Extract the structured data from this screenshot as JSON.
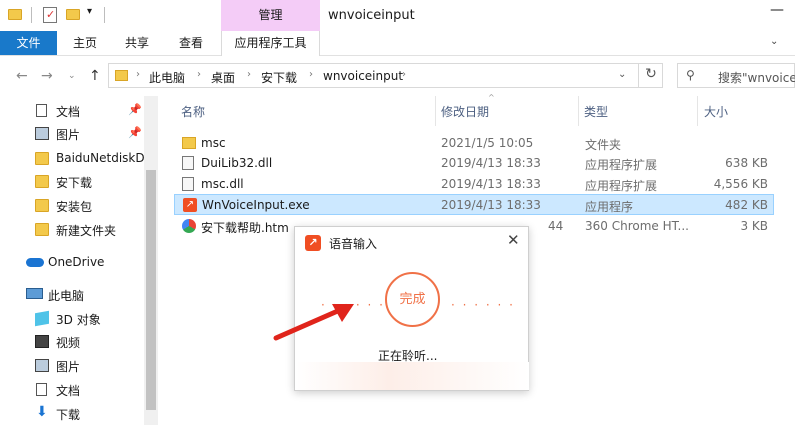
{
  "titlebar": {
    "context_tab": "管理",
    "window_title": "wnvoiceinput",
    "minimize_icon": "—"
  },
  "ribbon": {
    "tabs": [
      "文件",
      "主页",
      "共享",
      "查看",
      "应用程序工具"
    ]
  },
  "address": {
    "crumbs": [
      "此电脑",
      "桌面",
      "安下载",
      "wnvoiceinput"
    ],
    "search_placeholder": "搜索\"wnvoiceinput\""
  },
  "sidebar": {
    "items": [
      {
        "label": "文档",
        "icon": "document-icon",
        "pinned": true
      },
      {
        "label": "图片",
        "icon": "picture-icon",
        "pinned": true
      },
      {
        "label": "BaiduNetdiskD",
        "icon": "folder-icon",
        "pinned": false
      },
      {
        "label": "安下载",
        "icon": "folder-icon",
        "pinned": false
      },
      {
        "label": "安装包",
        "icon": "folder-icon",
        "pinned": false
      },
      {
        "label": "新建文件夹",
        "icon": "folder-icon",
        "pinned": false
      },
      {
        "label": "OneDrive",
        "icon": "onedrive-icon",
        "pinned": false
      },
      {
        "label": "此电脑",
        "icon": "computer-icon",
        "pinned": false
      },
      {
        "label": "3D 对象",
        "icon": "3d-objects-icon",
        "pinned": false
      },
      {
        "label": "视频",
        "icon": "video-icon",
        "pinned": false
      },
      {
        "label": "图片",
        "icon": "picture-icon",
        "pinned": false
      },
      {
        "label": "文档",
        "icon": "document-icon",
        "pinned": false
      },
      {
        "label": "下载",
        "icon": "download-icon",
        "pinned": false
      }
    ]
  },
  "filelist": {
    "columns": [
      "名称",
      "修改日期",
      "类型",
      "大小"
    ],
    "rows": [
      {
        "name": "msc",
        "date": "2021/1/5 10:05",
        "type": "文件夹",
        "size": "",
        "icon": "folder-icon"
      },
      {
        "name": "DuiLib32.dll",
        "date": "2019/4/13 18:33",
        "type": "应用程序扩展",
        "size": "638 KB",
        "icon": "dll-icon"
      },
      {
        "name": "msc.dll",
        "date": "2019/4/13 18:33",
        "type": "应用程序扩展",
        "size": "4,556 KB",
        "icon": "dll-icon"
      },
      {
        "name": "WnVoiceInput.exe",
        "date": "2019/4/13 18:33",
        "type": "应用程序",
        "size": "482 KB",
        "icon": "exe-icon"
      },
      {
        "name": "安下载帮助.htm",
        "date": "44",
        "type": "360 Chrome HT...",
        "size": "3 KB",
        "icon": "htm-icon"
      }
    ]
  },
  "dialog": {
    "title": "语音输入",
    "button": "完成",
    "status": "正在聆听...",
    "accent": "#f07147"
  },
  "colors": {
    "file_tab": "#1979ca",
    "context_tab": "#f4ccf7",
    "selection": "#cce8ff"
  }
}
